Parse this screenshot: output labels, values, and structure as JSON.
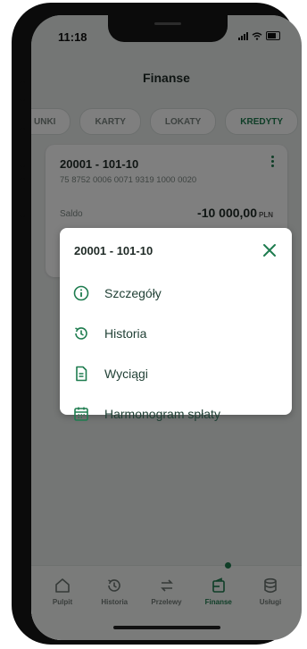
{
  "status": {
    "time": "11:18"
  },
  "header": {
    "title": "Finanse"
  },
  "tabs": [
    {
      "label": "UNKI"
    },
    {
      "label": "KARTY"
    },
    {
      "label": "LOKATY"
    },
    {
      "label": "KREDYTY",
      "active": true
    }
  ],
  "account": {
    "number": "20001 - 101-10",
    "iban": "75 8752 0006 0071 9319 1000 0020",
    "saldo_label": "Saldo",
    "saldo_value": "-10 000,00",
    "currency": "PLN"
  },
  "modal": {
    "title": "20001 - 101-10",
    "items": [
      {
        "label": "Szczegóły",
        "icon": "info-icon"
      },
      {
        "label": "Historia",
        "icon": "history-icon"
      },
      {
        "label": "Wyciągi",
        "icon": "document-icon"
      },
      {
        "label": "Harmonogram spłaty",
        "icon": "calendar-icon"
      }
    ]
  },
  "bottom_nav": {
    "items": [
      {
        "label": "Pulpit",
        "icon": "home-icon"
      },
      {
        "label": "Historia",
        "icon": "history-icon"
      },
      {
        "label": "Przelewy",
        "icon": "transfer-icon"
      },
      {
        "label": "Finanse",
        "icon": "finance-icon",
        "active": true
      },
      {
        "label": "Usługi",
        "icon": "services-icon"
      }
    ]
  },
  "colors": {
    "accent": "#1e7c4f",
    "overlay": "rgba(0,0,0,0.5)"
  }
}
